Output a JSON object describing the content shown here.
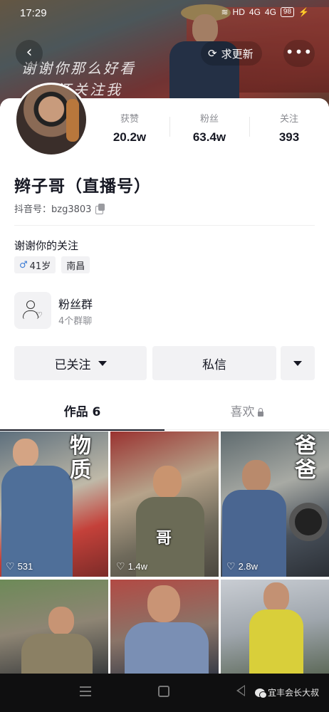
{
  "status_bar": {
    "time": "17:29",
    "signal_1": "4G",
    "signal_2": "4G",
    "battery": "98"
  },
  "header": {
    "banner_text_line1": "谢谢你那么好看",
    "banner_text_line2": "还关注我",
    "seek_update_label": "求更新",
    "back_icon": "back-arrow-icon",
    "more_icon": "ellipsis-icon"
  },
  "profile": {
    "stats": [
      {
        "label": "获赞",
        "value": "20.2w"
      },
      {
        "label": "粉丝",
        "value": "63.4w"
      },
      {
        "label": "关注",
        "value": "393"
      }
    ],
    "nickname": "辫子哥（直播号）",
    "douyin_id": "抖音号：bzg3803",
    "bio": "谢谢你的关注",
    "tags": {
      "gender_symbol": "♂",
      "age": "41岁",
      "location": "南昌"
    },
    "fan_group": {
      "title": "粉丝群",
      "subtitle": "4个群聊"
    },
    "actions": {
      "followed_label": "已关注",
      "message_label": "私信"
    }
  },
  "tabs": [
    {
      "label": "作品 6",
      "active": true
    },
    {
      "label": "喜欢",
      "locked": true
    }
  ],
  "videos": [
    {
      "likes": "531",
      "caption": "物质"
    },
    {
      "likes": "1.4w",
      "caption": "哥"
    },
    {
      "likes": "2.8w",
      "caption": "爸爸"
    },
    {
      "likes": ""
    },
    {
      "likes": ""
    },
    {
      "likes": ""
    }
  ],
  "bottom_nav": {
    "watermark": "宜丰会长大叔"
  },
  "colors": {
    "text_primary": "#161823",
    "text_secondary": "#8a8b91",
    "button_bg": "#f2f2f4",
    "male_blue": "#3a7bd5"
  }
}
